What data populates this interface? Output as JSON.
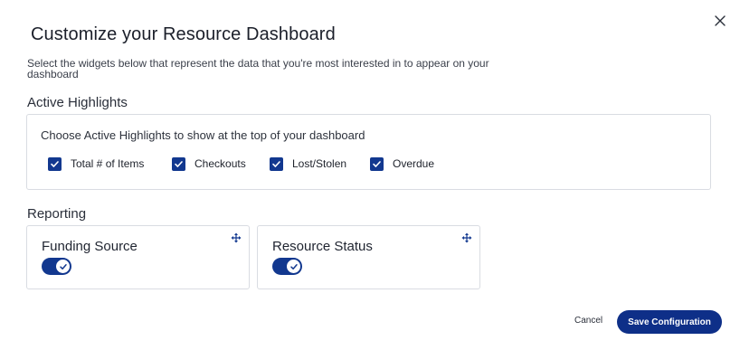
{
  "dialog": {
    "title": "Customize your Resource Dashboard",
    "subtitle": "Select the widgets below that represent the data that you're most interested in to appear on your dashboard",
    "close_icon": "close-icon"
  },
  "active_highlights": {
    "heading": "Active Highlights",
    "instruction": "Choose Active Highlights to show at the top of your dashboard",
    "options": [
      {
        "label": "Total # of Items",
        "checked": true
      },
      {
        "label": "Checkouts",
        "checked": true
      },
      {
        "label": "Lost/Stolen",
        "checked": true
      },
      {
        "label": "Overdue",
        "checked": true
      }
    ]
  },
  "reporting": {
    "heading": "Reporting",
    "widgets": [
      {
        "title": "Funding Source",
        "enabled": true,
        "icon": "move-icon"
      },
      {
        "title": "Resource Status",
        "enabled": true,
        "icon": "move-icon"
      }
    ]
  },
  "footer": {
    "cancel_label": "Cancel",
    "save_label": "Save Configuration"
  },
  "colors": {
    "accent": "#12388f",
    "button": "#0e2f88",
    "border": "#d9dce2"
  }
}
